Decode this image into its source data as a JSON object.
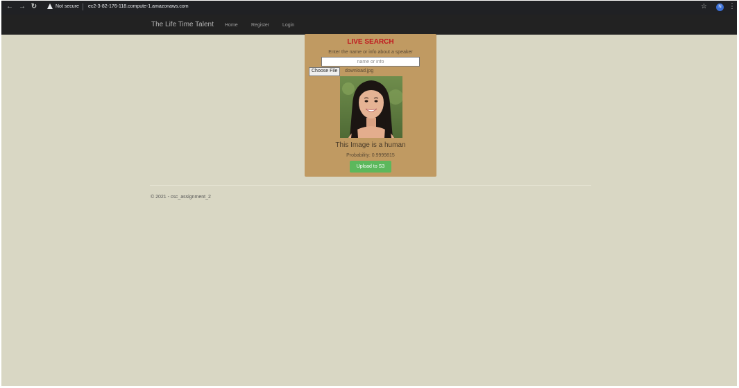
{
  "browser": {
    "security_label": "Not secure",
    "url": "ec2-3-82-176-118.compute-1.amazonaws.com",
    "profile_initial": "N",
    "icons": [
      "back-arrow-icon",
      "forward-arrow-icon",
      "reload-icon",
      "warning-icon",
      "star-icon",
      "kebab-menu-icon"
    ]
  },
  "navbar": {
    "brand": "The Life Time Talent",
    "links": [
      "Home",
      "Register",
      "Login"
    ]
  },
  "search": {
    "title": "LIVE SEARCH",
    "instruction": "Enter the name or info about a speaker",
    "placeholder": "name or info",
    "file_button": "Choose File",
    "file_name": "download.jpg",
    "result": "This Image is a human",
    "probability": "Probability: 0.9999815",
    "upload_button": "Upload to S3"
  },
  "footer": {
    "text": "© 2021 - csc_assignment_2"
  },
  "colors": {
    "page_bg": "#d9d7c4",
    "navbar_bg": "#222222",
    "card_bg": "#c09a62",
    "title_red": "#c0181e",
    "upload_green": "#5cb85c"
  }
}
